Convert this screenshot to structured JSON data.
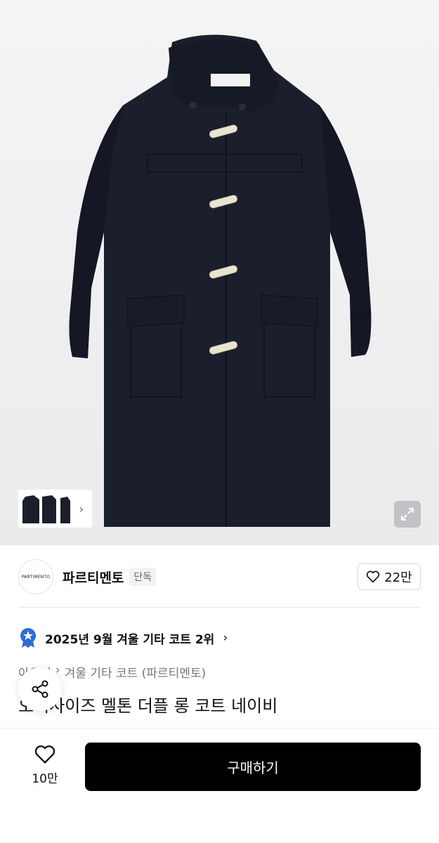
{
  "hero": {
    "image_alt": "navy duffle coat",
    "thumbnail_more": "›"
  },
  "brand": {
    "logo_text": "PARTIMENTO",
    "name": "파르티멘토",
    "badge": "단독",
    "likes": "22만"
  },
  "ranking": {
    "text": "2025년 9월 겨울 기타 코트 2위",
    "chevron": "›"
  },
  "breadcrumb": {
    "parent": "아우터",
    "separator": "›",
    "current": "겨울 기타 코트 (파르티멘토)"
  },
  "product": {
    "title": "오버사이즈 멜톤 더플 롱 코트 네이비"
  },
  "bottom": {
    "wish_count": "10만",
    "buy_label": "구매하기"
  },
  "colors": {
    "coat": "#1b1f2c",
    "toggle": "#e9e4cf",
    "rank_badge": "#2f6bd8",
    "buy_button": "#000000"
  }
}
